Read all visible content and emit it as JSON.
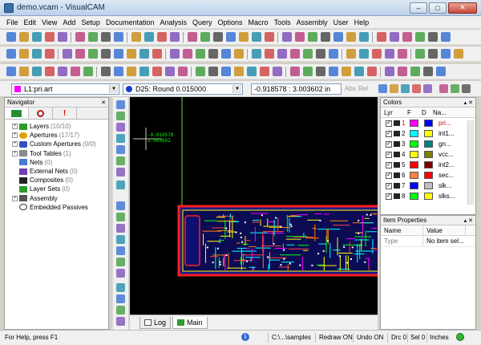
{
  "window": {
    "title": "demo.vcam - VisualCAM",
    "minimize_glyph": "–",
    "maximize_glyph": "□",
    "close_glyph": "✕",
    "accent_color": "#3a6ea5"
  },
  "menu": {
    "items": [
      "File",
      "Edit",
      "View",
      "Add",
      "Setup",
      "Documentation",
      "Analysis",
      "Query",
      "Options",
      "Macro",
      "Tools",
      "Assembly",
      "User",
      "Help"
    ]
  },
  "selection_bar": {
    "layer_value": "L1:pri.art",
    "aperture_value": "D25: Round 0.015000",
    "coordinate_value": "-0.918578 : 3.003602 in",
    "abs_label": "Abs",
    "rel_label": "Rel"
  },
  "navigator": {
    "title": "Navigator",
    "close_glyph": "✕",
    "items": [
      {
        "label": "Layers",
        "count": "(10/10)",
        "expandable": true
      },
      {
        "label": "Apertures",
        "count": "(17/17)",
        "expandable": true
      },
      {
        "label": "Custom Apertures",
        "count": "(0/0)",
        "expandable": true
      },
      {
        "label": "Tool Tables",
        "count": "(1)",
        "expandable": true
      },
      {
        "label": "Nets",
        "count": "(0)",
        "expandable": false
      },
      {
        "label": "External Nets",
        "count": "(0)",
        "expandable": false
      },
      {
        "label": "Composites",
        "count": "(0)",
        "expandable": false
      },
      {
        "label": "Layer Sets",
        "count": "(0)",
        "expandable": false
      },
      {
        "label": "Assembly",
        "count": "",
        "expandable": true
      },
      {
        "label": "Embedded Passives",
        "count": "",
        "expandable": false
      }
    ]
  },
  "canvas": {
    "cursor_x": "-0.918578",
    "cursor_y": "3.003602",
    "tabs": [
      "Log",
      "Main"
    ],
    "active_tab": "Main"
  },
  "colors_panel": {
    "title": "Colors",
    "headers": {
      "lyr": "Lyr",
      "f": "F",
      "d": "D",
      "name": "Na..."
    },
    "rows": [
      {
        "num": "1",
        "name": "pri...",
        "f": "#ff00ff",
        "d": "#0000ff",
        "selected": true
      },
      {
        "num": "2",
        "name": "int1...",
        "f": "#00ffff",
        "d": "#ffff00",
        "selected": false
      },
      {
        "num": "3",
        "name": "gn...",
        "f": "#00ff00",
        "d": "#008080",
        "selected": false
      },
      {
        "num": "4",
        "name": "vcc...",
        "f": "#ffff00",
        "d": "#808000",
        "selected": false
      },
      {
        "num": "5",
        "name": "int2...",
        "f": "#ff0000",
        "d": "#800000",
        "selected": false
      },
      {
        "num": "6",
        "name": "sec...",
        "f": "#ff8040",
        "d": "#ff0000",
        "selected": false
      },
      {
        "num": "7",
        "name": "slk...",
        "f": "#0000ff",
        "d": "#c0c0c0",
        "selected": false
      },
      {
        "num": "8",
        "name": "slks...",
        "f": "#00ff00",
        "d": "#ffff00",
        "selected": false
      }
    ]
  },
  "properties_panel": {
    "title": "Item Properties",
    "headers": [
      "Name",
      "Value"
    ],
    "rows": [
      {
        "name": "Type",
        "value": "No item sel..."
      }
    ]
  },
  "statusbar": {
    "help": "For Help, press F1",
    "path": "C:\\...\\samples",
    "redraw": "Redraw ON",
    "undo": "Undo ON",
    "drc": "Drc 0",
    "sel": "Sel 0",
    "units": "Inches"
  }
}
